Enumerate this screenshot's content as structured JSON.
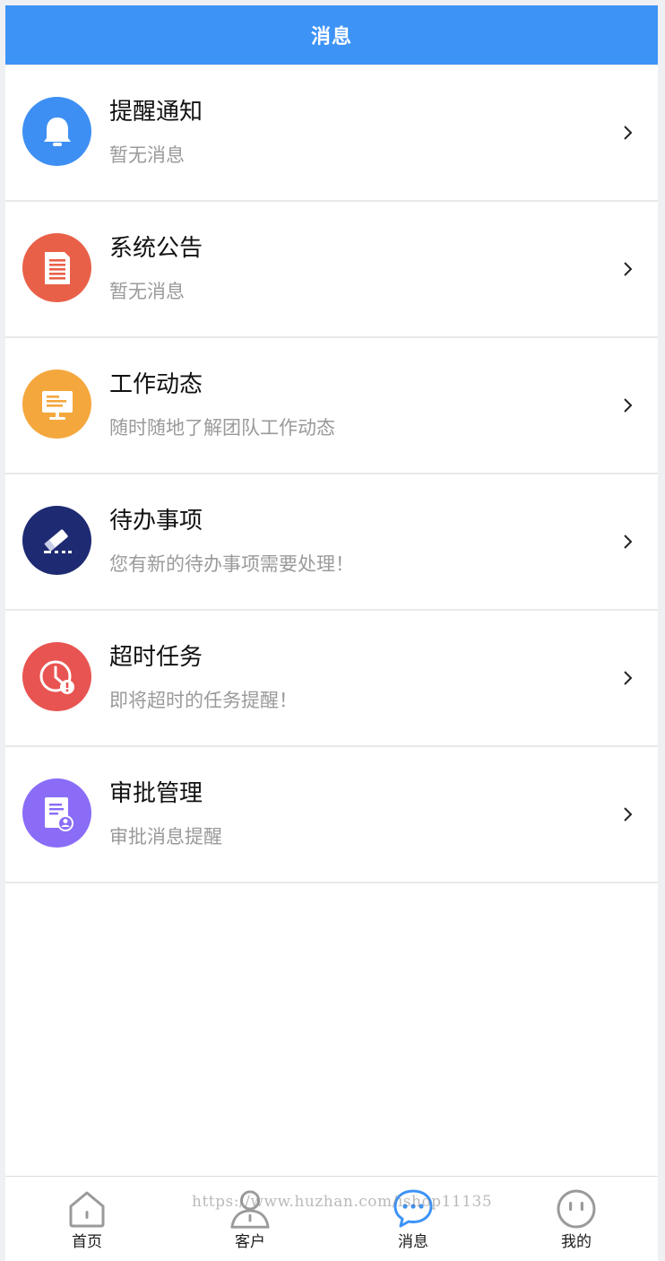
{
  "header": {
    "title": "消息"
  },
  "messages": [
    {
      "title": "提醒通知",
      "desc": "暂无消息",
      "icon": "bell-icon",
      "color": "#3d8ff3"
    },
    {
      "title": "系统公告",
      "desc": "暂无消息",
      "icon": "document-icon",
      "color": "#e96049"
    },
    {
      "title": "工作动态",
      "desc": "随时随地了解团队工作动态",
      "icon": "monitor-icon",
      "color": "#f4a73c"
    },
    {
      "title": "待办事项",
      "desc": "您有新的待办事项需要处理！",
      "icon": "edit-icon",
      "color": "#1e2a72"
    },
    {
      "title": "超时任务",
      "desc": "即将超时的任务提醒！",
      "icon": "clock-alert-icon",
      "color": "#e85451"
    },
    {
      "title": "审批管理",
      "desc": "审批消息提醒",
      "icon": "approval-icon",
      "color": "#8a6cf7"
    }
  ],
  "tabbar": {
    "items": [
      {
        "label": "首页",
        "icon": "home-icon",
        "active": false
      },
      {
        "label": "客户",
        "icon": "user-icon",
        "active": false
      },
      {
        "label": "消息",
        "icon": "chat-icon",
        "active": true
      },
      {
        "label": "我的",
        "icon": "face-icon",
        "active": false
      }
    ],
    "active_color": "#3d93f6",
    "inactive_color": "#9a9a9a"
  },
  "watermark": "https://www.huzhan.com/ishop11135"
}
